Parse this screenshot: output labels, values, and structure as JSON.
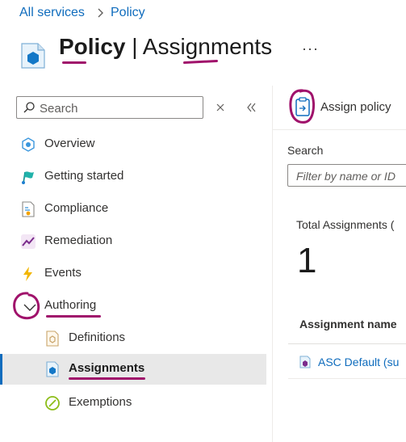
{
  "breadcrumb": {
    "items": [
      "All services",
      "Policy"
    ],
    "separator": ">"
  },
  "header": {
    "title_main": "Policy",
    "title_sep": " | ",
    "title_sub": "Assignments",
    "more": "···",
    "icon": "policy-icon"
  },
  "sidebar": {
    "search_placeholder": "Search",
    "clear_icon": "close-icon",
    "collapse_icon": "double-chevron-left-icon",
    "items": [
      {
        "label": "Overview",
        "icon": "overview-icon"
      },
      {
        "label": "Getting started",
        "icon": "rocket-flag-icon"
      },
      {
        "label": "Compliance",
        "icon": "compliance-icon"
      },
      {
        "label": "Remediation",
        "icon": "remediation-icon"
      },
      {
        "label": "Events",
        "icon": "lightning-icon"
      },
      {
        "label": "Authoring",
        "icon": "chevron-down-icon"
      },
      {
        "label": "Definitions",
        "icon": "definition-icon"
      },
      {
        "label": "Assignments",
        "icon": "assignment-icon"
      },
      {
        "label": "Exemptions",
        "icon": "exemption-icon"
      }
    ],
    "active": "Assignments"
  },
  "main": {
    "assign_policy_label": "Assign policy",
    "search_label": "Search",
    "filter_placeholder": "Filter by name or ID",
    "total_label": "Total Assignments (",
    "total_value": "1",
    "column_header": "Assignment name",
    "row_name": "ASC Default (su"
  },
  "colors": {
    "accent": "#0f6cbd",
    "annotation": "#a0126b",
    "active_bg": "#e8e8e8"
  }
}
